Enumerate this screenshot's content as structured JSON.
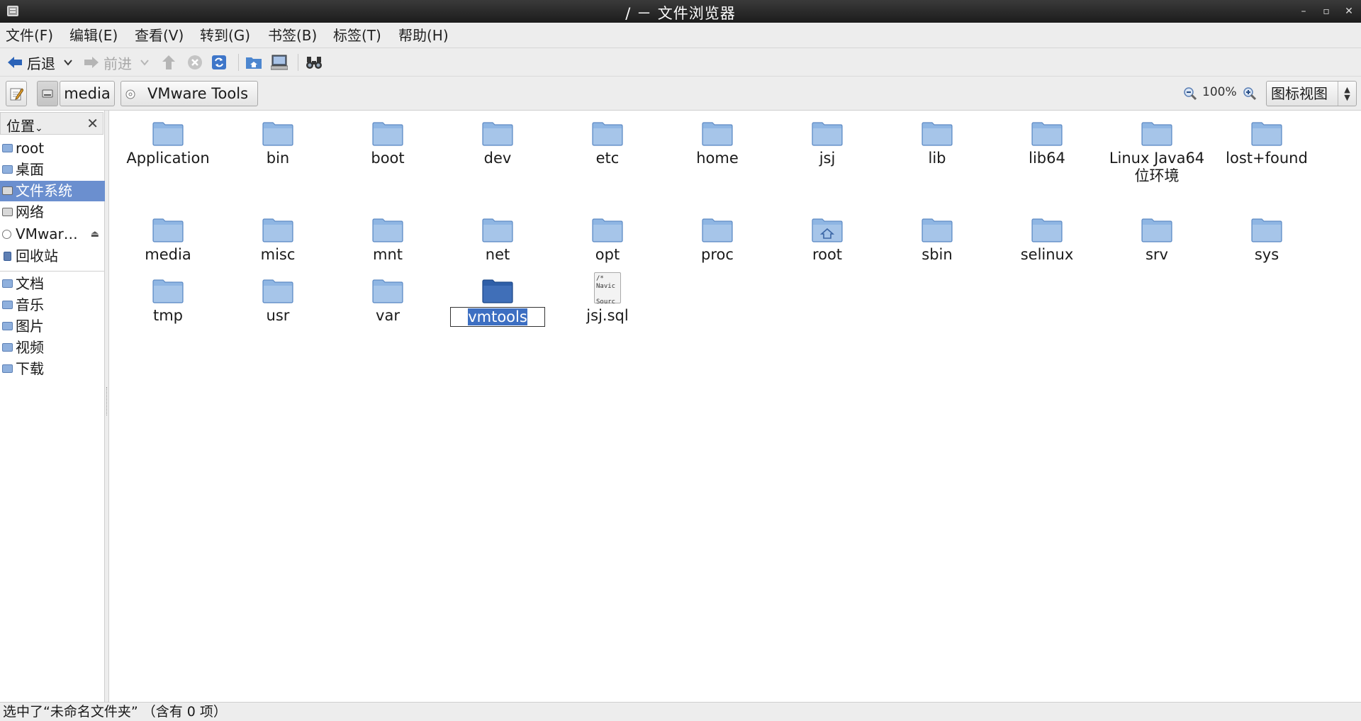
{
  "window": {
    "title": "/ － 文件浏览器"
  },
  "menu": [
    "文件(F)",
    "编辑(E)",
    "查看(V)",
    "转到(G)",
    "书签(B)",
    "标签(T)",
    "帮助(H)"
  ],
  "toolbar": {
    "back_label": "后退",
    "forward_label": "前进"
  },
  "location": {
    "path": [
      "media",
      "VMware Tools"
    ],
    "zoom": "100%",
    "view_mode": "图标视图"
  },
  "sidebar": {
    "header": "位置",
    "places": [
      {
        "label": "root",
        "icon": "home-folder-icon"
      },
      {
        "label": "桌面",
        "icon": "desktop-folder-icon"
      },
      {
        "label": "文件系统",
        "icon": "drive-icon",
        "selected": true
      },
      {
        "label": "网络",
        "icon": "network-icon"
      },
      {
        "label": "VMwar…",
        "icon": "cdrom-icon",
        "eject": true
      },
      {
        "label": "回收站",
        "icon": "trash-icon"
      }
    ],
    "bookmarks": [
      {
        "label": "文档",
        "icon": "documents-folder-icon"
      },
      {
        "label": "音乐",
        "icon": "music-folder-icon"
      },
      {
        "label": "图片",
        "icon": "pictures-folder-icon"
      },
      {
        "label": "视频",
        "icon": "videos-folder-icon"
      },
      {
        "label": "下载",
        "icon": "downloads-folder-icon"
      }
    ]
  },
  "files": [
    {
      "name": "Application",
      "type": "folder"
    },
    {
      "name": "bin",
      "type": "folder"
    },
    {
      "name": "boot",
      "type": "folder"
    },
    {
      "name": "dev",
      "type": "folder"
    },
    {
      "name": "etc",
      "type": "folder"
    },
    {
      "name": "home",
      "type": "folder"
    },
    {
      "name": "jsj",
      "type": "folder"
    },
    {
      "name": "lib",
      "type": "folder"
    },
    {
      "name": "lib64",
      "type": "folder"
    },
    {
      "name": "Linux Java64位环境",
      "type": "folder"
    },
    {
      "name": "lost+found",
      "type": "folder"
    },
    {
      "name": "media",
      "type": "folder"
    },
    {
      "name": "misc",
      "type": "folder"
    },
    {
      "name": "mnt",
      "type": "folder"
    },
    {
      "name": "net",
      "type": "folder"
    },
    {
      "name": "opt",
      "type": "folder"
    },
    {
      "name": "proc",
      "type": "folder"
    },
    {
      "name": "root",
      "type": "home-folder"
    },
    {
      "name": "sbin",
      "type": "folder"
    },
    {
      "name": "selinux",
      "type": "folder"
    },
    {
      "name": "srv",
      "type": "folder"
    },
    {
      "name": "sys",
      "type": "folder"
    },
    {
      "name": "tmp",
      "type": "folder"
    },
    {
      "name": "usr",
      "type": "folder"
    },
    {
      "name": "var",
      "type": "folder"
    },
    {
      "name": "vmtools",
      "type": "folder",
      "selected": true,
      "renaming": true
    },
    {
      "name": "jsj.sql",
      "type": "sql-file",
      "preview": "/*\nNavic\n\nSourc"
    }
  ],
  "colors": {
    "folder": "#8fb6e3",
    "folder_selected": "#2f5fa8",
    "selection": "#6b8fcf"
  },
  "status": "选中了“未命名文件夹” （含有 0 项）"
}
